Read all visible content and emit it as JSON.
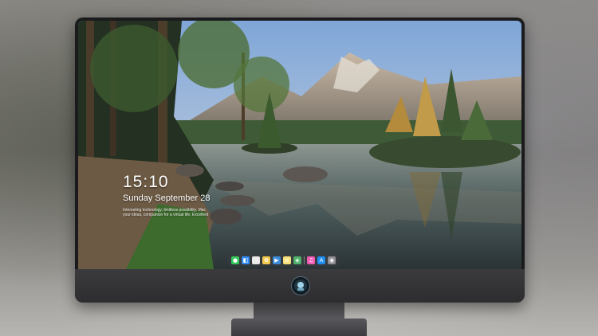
{
  "lockscreen": {
    "time": "15:10",
    "date": "Sunday September 28",
    "info_line_1": "Interesting technology, limitless possibility. Mac",
    "info_line_2": "your ideas, companion for a virtual life. Excellent"
  },
  "dock": {
    "icons": [
      {
        "name": "messages-icon",
        "color": "#34c759",
        "glyph": "●"
      },
      {
        "name": "finder-icon",
        "color": "#2f8cf6",
        "glyph": "◧"
      },
      {
        "name": "clock-icon",
        "color": "#e8e8e8",
        "glyph": "◷"
      },
      {
        "name": "photos-icon",
        "color": "#f2c94c",
        "glyph": "✿"
      },
      {
        "name": "video-icon",
        "color": "#3c8cd9",
        "glyph": "▶"
      },
      {
        "name": "notes-icon",
        "color": "#f7e27a",
        "glyph": "≡"
      },
      {
        "name": "maps-icon",
        "color": "#4fb26b",
        "glyph": "◈"
      },
      {
        "name": "music-icon",
        "color": "#f15bb5",
        "glyph": "♫"
      },
      {
        "name": "appstore-icon",
        "color": "#1f8ef1",
        "glyph": "A"
      },
      {
        "name": "camera-icon",
        "color": "#8e8e93",
        "glyph": "◉"
      }
    ]
  },
  "colors": {
    "sky": "#8fb1d8",
    "water": "#3e4d55",
    "bezel": "#1b1b1d"
  }
}
